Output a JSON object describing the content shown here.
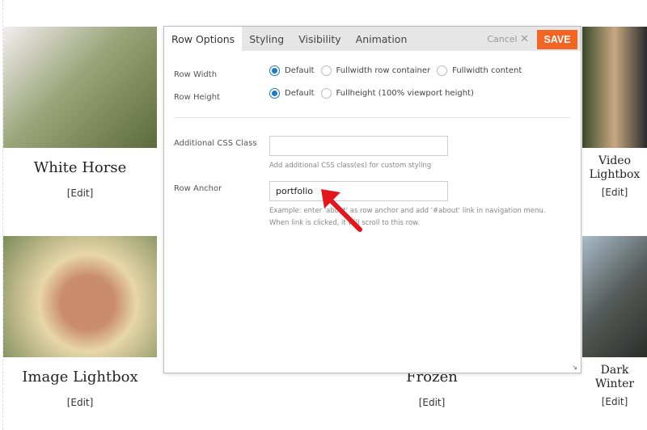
{
  "gallery": [
    {
      "title": "White Horse",
      "edit": "[Edit]",
      "color": "#9aa57a"
    },
    {
      "title": "Video Lightbox",
      "edit": "[Edit]",
      "color": "#7a6a55"
    },
    {
      "title": "Image Lightbox",
      "edit": "[Edit]",
      "color": "#d8b58e"
    },
    {
      "title": "Frozen",
      "edit": "[Edit]"
    },
    {
      "title": "Dark Winter",
      "edit": "[Edit]",
      "color": "#6d7a80"
    }
  ],
  "modal": {
    "tabs": [
      "Row Options",
      "Styling",
      "Visibility",
      "Animation"
    ],
    "active_tab": "Row Options",
    "cancel_label": "Cancel",
    "save_label": "SAVE",
    "save_color": "#f26522",
    "row_width": {
      "label": "Row Width",
      "options": [
        "Default",
        "Fullwidth row container",
        "Fullwidth content"
      ],
      "selected": "Default"
    },
    "row_height": {
      "label": "Row Height",
      "options": [
        "Default",
        "Fullheight (100% viewport height)"
      ],
      "selected": "Default"
    },
    "css_class": {
      "label": "Additional CSS Class",
      "value": "",
      "help": "Add additional CSS class(es) for custom styling"
    },
    "row_anchor": {
      "label": "Row Anchor",
      "value": "portfolio",
      "help1": "Example: enter 'about' as row anchor and add '#about' link in navigation menu.",
      "help2": "When link is clicked, it will scroll to this row."
    }
  }
}
